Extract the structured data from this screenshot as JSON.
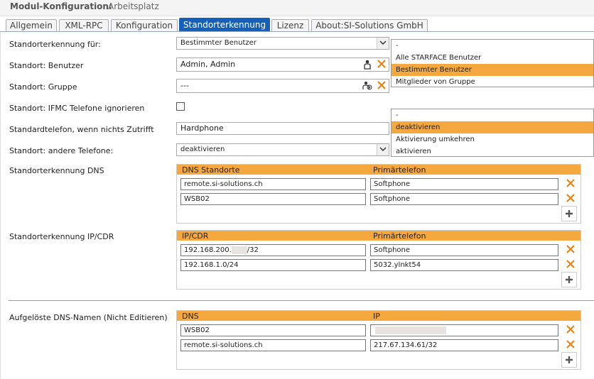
{
  "header": {
    "title": "Modul-Konfiguration:",
    "subtitle": "Arbeitsplatz"
  },
  "tabs": [
    {
      "label": "Allgemein"
    },
    {
      "label": "XML-RPC"
    },
    {
      "label": "Konfiguration"
    },
    {
      "label": "Standorterkennung"
    },
    {
      "label": "Lizenz"
    },
    {
      "label": "About:SI-Solutions GmbH"
    }
  ],
  "form": {
    "standorterkennung_fuer": {
      "label": "Standorterkennung für:",
      "value": "Bestimmter Benutzer"
    },
    "benutzer": {
      "label": "Standort: Benutzer",
      "value": "Admin, Admin"
    },
    "gruppe": {
      "label": "Standort: Gruppe",
      "value": "---"
    },
    "ifmc": {
      "label": "Standort: IFMC Telefone ignorieren"
    },
    "standardtelefon": {
      "label": "Standardtelefon, wenn nichts Zutrifft",
      "value": "Hardphone"
    },
    "andere": {
      "label": "Standort: andere Telefone:",
      "value": "deaktivieren"
    }
  },
  "dropdown1": {
    "options": [
      "-",
      "Alle STARFACE Benutzer",
      "Bestimmter Benutzer",
      "Mitglieder von Gruppe"
    ],
    "selected": 2
  },
  "dropdown2": {
    "options": [
      "-",
      "deaktivieren",
      "Aktivierung umkehren",
      "aktivieren"
    ],
    "selected": 1
  },
  "dns_table": {
    "label": "Standorterkennung DNS",
    "headers": [
      "DNS Standorte",
      "Primärtelefon"
    ],
    "rows": [
      [
        "remote.si-solutions.ch",
        "Softphone"
      ],
      [
        "WSB02",
        "Softphone"
      ]
    ]
  },
  "ip_table": {
    "label": "Standorterkennung IP/CDR",
    "headers": [
      "IP/CDR",
      "Primärtelefon"
    ],
    "rows": [
      [
        "192.168.200.",
        "/32",
        "Softphone"
      ],
      [
        "192.168.1.0/24",
        "",
        "5032.ylnkt54"
      ]
    ]
  },
  "resolved_table": {
    "label": "Aufgelöste DNS-Namen (Nicht Editieren)",
    "headers": [
      "DNS",
      "IP"
    ],
    "rows": [
      [
        "WSB02",
        ""
      ],
      [
        "remote.si-solutions.ch",
        "217.67.134.61/32"
      ]
    ]
  },
  "colors": {
    "accent": "#f5a83e",
    "tab_active": "#1560b8",
    "delete": "#e8851a"
  },
  "icons": {
    "delete": "close-icon",
    "add": "plus-icon",
    "user": "user-icon",
    "group": "group-icon"
  }
}
